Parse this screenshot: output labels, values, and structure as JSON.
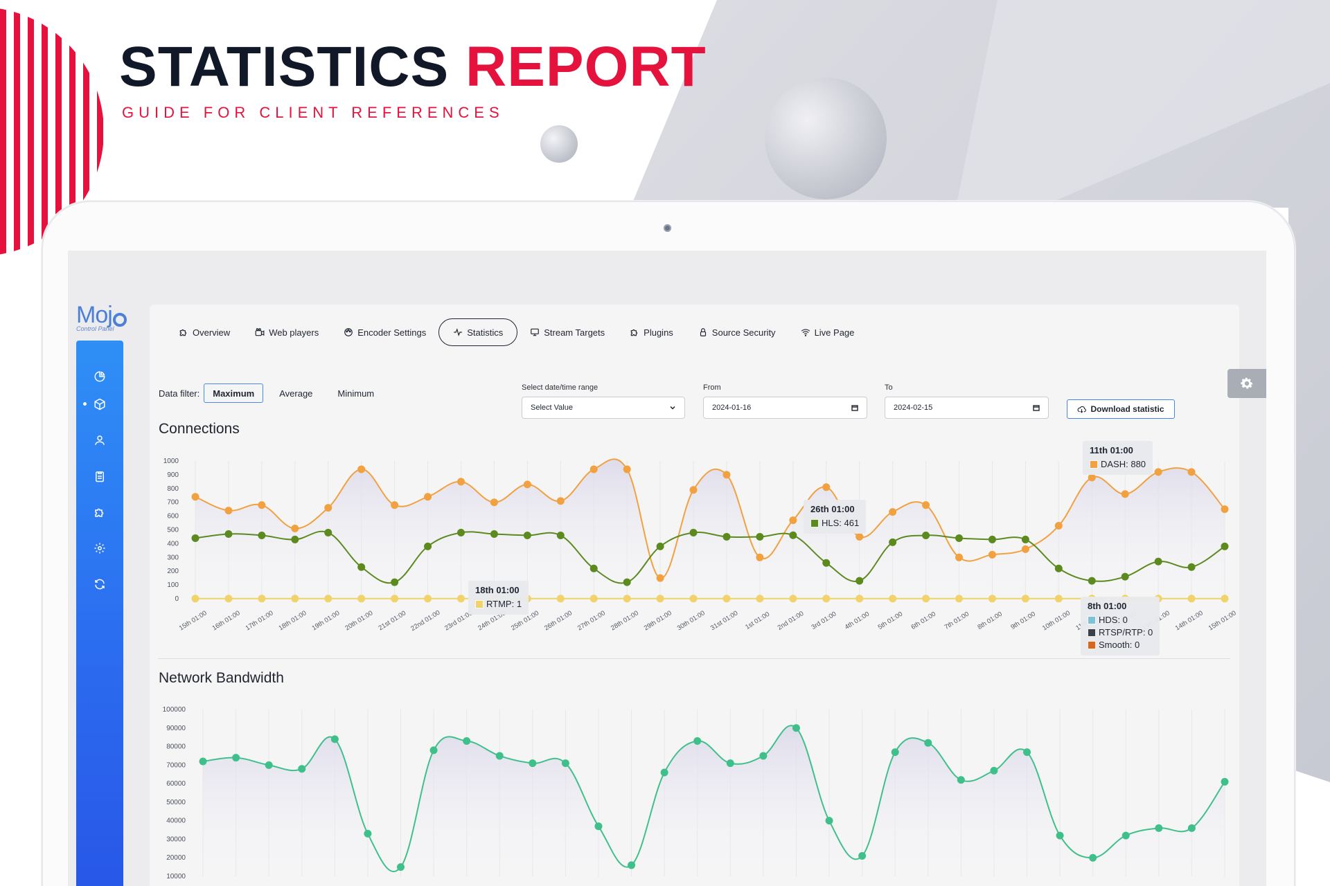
{
  "headline": {
    "part1": "STATISTICS",
    "part2": "REPORT",
    "subtitle": "GUIDE FOR CLIENT REFERENCES"
  },
  "logo": {
    "text": "Moj",
    "sub": "Control Panel"
  },
  "sidebar": {
    "items": [
      {
        "icon": "pie-chart-icon",
        "active": false
      },
      {
        "icon": "box-icon",
        "active": true
      },
      {
        "icon": "user-icon",
        "active": false
      },
      {
        "icon": "clipboard-icon",
        "active": false
      },
      {
        "icon": "puzzle-icon",
        "active": false
      },
      {
        "icon": "gear-icon",
        "active": false
      },
      {
        "icon": "refresh-icon",
        "active": false
      }
    ]
  },
  "tabs": [
    {
      "label": "Overview",
      "icon": "puzzle-icon",
      "active": false
    },
    {
      "label": "Web players",
      "icon": "video-icon",
      "active": false
    },
    {
      "label": "Encoder Settings",
      "icon": "palette-icon",
      "active": false
    },
    {
      "label": "Statistics",
      "icon": "pulse-icon",
      "active": true
    },
    {
      "label": "Stream Targets",
      "icon": "monitor-icon",
      "active": false
    },
    {
      "label": "Plugins",
      "icon": "puzzle-icon",
      "active": false
    },
    {
      "label": "Source Security",
      "icon": "lock-icon",
      "active": false
    },
    {
      "label": "Live Page",
      "icon": "wifi-icon",
      "active": false
    }
  ],
  "filters": {
    "label": "Data filter:",
    "options": [
      "Maximum",
      "Average",
      "Minimum"
    ],
    "selected": "Maximum",
    "range_label": "Select date/time range",
    "range_value": "Select Value",
    "from_label": "From",
    "from_value": "2024-01-16",
    "to_label": "To",
    "to_value": "2024-02-15",
    "download_label": "Download statistic"
  },
  "connections": {
    "title": "Connections",
    "tooltips": {
      "dash": {
        "title": "11th 01:00",
        "label": "DASH: 880"
      },
      "hls": {
        "title": "26th 01:00",
        "label": "HLS: 461"
      },
      "rtmp": {
        "title": "18th 01:00",
        "label": "RTMP: 1"
      },
      "multi": {
        "title": "8th 01:00",
        "rows": [
          "HDS: 0",
          "RTSP/RTP: 0",
          "Smooth: 0"
        ]
      }
    }
  },
  "bandwidth": {
    "title": "Network Bandwidth"
  },
  "colors": {
    "dash": "#f2a140",
    "hls": "#5d8a1f",
    "rtmp": "#f0d36a",
    "hds": "#7ec2d6",
    "rtsp": "#3a3f4a",
    "smooth": "#d9661b",
    "bandwidth": "#3fc08a",
    "accent": "#e5123d",
    "primary": "#2f7df0"
  },
  "chart_data": [
    {
      "type": "line",
      "ylim": [
        0,
        1000
      ],
      "yticks": [
        0,
        100,
        200,
        300,
        400,
        500,
        600,
        700,
        800,
        900,
        1000
      ],
      "categories": [
        "15th 01:00",
        "16th 01:00",
        "17th 01:00",
        "18th 01:00",
        "19th 01:00",
        "20th 01:00",
        "21st 01:00",
        "22nd 01:00",
        "23rd 01:00",
        "24th 01:00",
        "25th 01:00",
        "26th 01:00",
        "27th 01:00",
        "28th 01:00",
        "29th 01:00",
        "30th 01:00",
        "31st 01:00",
        "1st 01:00",
        "2nd 01:00",
        "3rd 01:00",
        "4th 01:00",
        "5th 01:00",
        "6th 01:00",
        "7th 01:00",
        "8th 01:00",
        "9th 01:00",
        "10th 01:00",
        "11th 01:00",
        "12th 01:00",
        "13th 01:00",
        "14th 01:00",
        "15th 01:00"
      ],
      "series": [
        {
          "name": "DASH",
          "values": [
            740,
            640,
            680,
            510,
            660,
            940,
            680,
            740,
            850,
            700,
            830,
            710,
            940,
            940,
            150,
            790,
            900,
            300,
            570,
            810,
            450,
            630,
            680,
            300,
            320,
            360,
            530,
            880,
            760,
            920,
            920,
            650
          ]
        },
        {
          "name": "HLS",
          "values": [
            440,
            470,
            460,
            430,
            480,
            230,
            120,
            380,
            480,
            470,
            460,
            460,
            220,
            120,
            380,
            480,
            450,
            450,
            461,
            260,
            130,
            410,
            460,
            440,
            430,
            430,
            220,
            130,
            160,
            270,
            230,
            380
          ]
        },
        {
          "name": "RTMP",
          "values": [
            1,
            1,
            1,
            1,
            1,
            1,
            1,
            1,
            1,
            1,
            1,
            1,
            1,
            1,
            1,
            1,
            1,
            1,
            1,
            1,
            1,
            1,
            1,
            1,
            1,
            1,
            1,
            1,
            1,
            1,
            1,
            1
          ]
        }
      ]
    },
    {
      "type": "line",
      "ylim": [
        10000,
        100000
      ],
      "yticks": [
        10000,
        20000,
        30000,
        40000,
        50000,
        60000,
        70000,
        80000,
        90000,
        100000
      ],
      "series": [
        {
          "name": "Bandwidth",
          "values": [
            72000,
            74000,
            70000,
            68000,
            84000,
            33000,
            15000,
            78000,
            83000,
            75000,
            71000,
            71000,
            37000,
            16000,
            66000,
            83000,
            71000,
            75000,
            90000,
            40000,
            21000,
            77000,
            82000,
            62000,
            67000,
            77000,
            32000,
            20000,
            32000,
            36000,
            36000,
            61000
          ]
        }
      ]
    }
  ]
}
